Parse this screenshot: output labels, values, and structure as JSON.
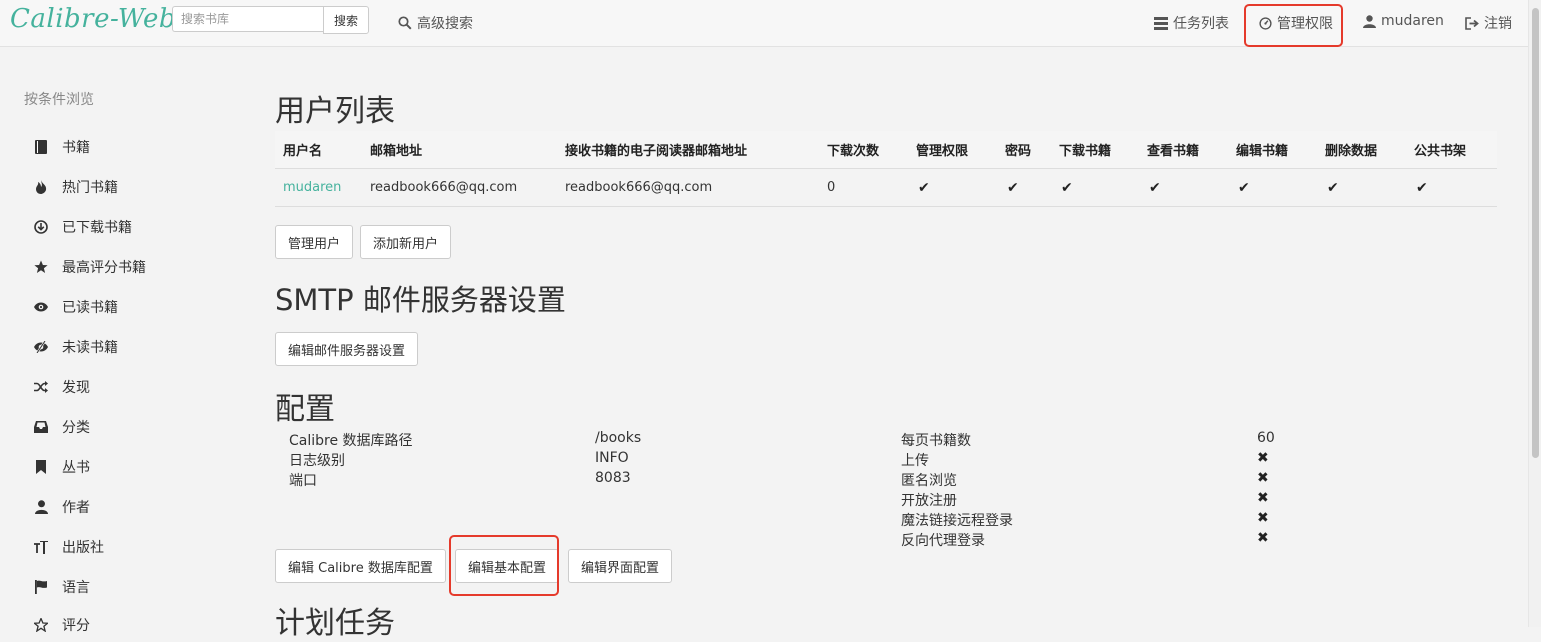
{
  "navbar": {
    "logo": "Calibre-Web",
    "search_placeholder": "搜索书库",
    "search_button": "搜索",
    "advanced_search": "高级搜索",
    "tasks": "任务列表",
    "admin": "管理权限",
    "user": "mudaren",
    "logout": "注销"
  },
  "sidebar": {
    "title": "按条件浏览",
    "items": [
      {
        "label": "书籍",
        "icon": "book-icon"
      },
      {
        "label": "热门书籍",
        "icon": "fire-icon"
      },
      {
        "label": "已下载书籍",
        "icon": "download-icon"
      },
      {
        "label": "最高评分书籍",
        "icon": "star-icon"
      },
      {
        "label": "已读书籍",
        "icon": "eye-icon"
      },
      {
        "label": "未读书籍",
        "icon": "eye-slash-icon"
      },
      {
        "label": "发现",
        "icon": "shuffle-icon"
      },
      {
        "label": "分类",
        "icon": "inbox-icon"
      },
      {
        "label": "丛书",
        "icon": "bookmark-icon"
      },
      {
        "label": "作者",
        "icon": "user-icon"
      },
      {
        "label": "出版社",
        "icon": "text-size-icon"
      },
      {
        "label": "语言",
        "icon": "flag-icon"
      },
      {
        "label": "评分",
        "icon": "star-outline-icon"
      }
    ]
  },
  "users_section": {
    "title": "用户列表",
    "columns": [
      "用户名",
      "邮箱地址",
      "接收书籍的电子阅读器邮箱地址",
      "下载次数",
      "管理权限",
      "密码",
      "下载书籍",
      "查看书籍",
      "编辑书籍",
      "删除数据",
      "公共书架"
    ],
    "rows": [
      {
        "username": "mudaren",
        "email": "readbook666@qq.com",
        "kindle_email": "readbook666@qq.com",
        "downloads": "0",
        "admin": "✔",
        "password": "✔",
        "download": "✔",
        "view": "✔",
        "edit": "✔",
        "delete": "✔",
        "public_shelf": "✔"
      }
    ],
    "buttons": {
      "manage_users": "管理用户",
      "add_user": "添加新用户"
    }
  },
  "smtp_section": {
    "title": "SMTP 邮件服务器设置",
    "edit_button": "编辑邮件服务器设置"
  },
  "config_section": {
    "title": "配置",
    "left": [
      {
        "label": "Calibre 数据库路径",
        "value": "/books"
      },
      {
        "label": "日志级别",
        "value": "INFO"
      },
      {
        "label": "端口",
        "value": "8083"
      }
    ],
    "right": [
      {
        "label": "每页书籍数",
        "value": "60"
      },
      {
        "label": "上传",
        "value": "✖"
      },
      {
        "label": "匿名浏览",
        "value": "✖"
      },
      {
        "label": "开放注册",
        "value": "✖"
      },
      {
        "label": "魔法链接远程登录",
        "value": "✖"
      },
      {
        "label": "反向代理登录",
        "value": "✖"
      }
    ],
    "buttons": {
      "edit_db": "编辑 Calibre 数据库配置",
      "edit_basic": "编辑基本配置",
      "edit_ui": "编辑界面配置"
    }
  },
  "scheduled_section": {
    "title": "计划任务"
  },
  "colors": {
    "accent": "#45b29d",
    "highlight": "#e53a2b"
  }
}
